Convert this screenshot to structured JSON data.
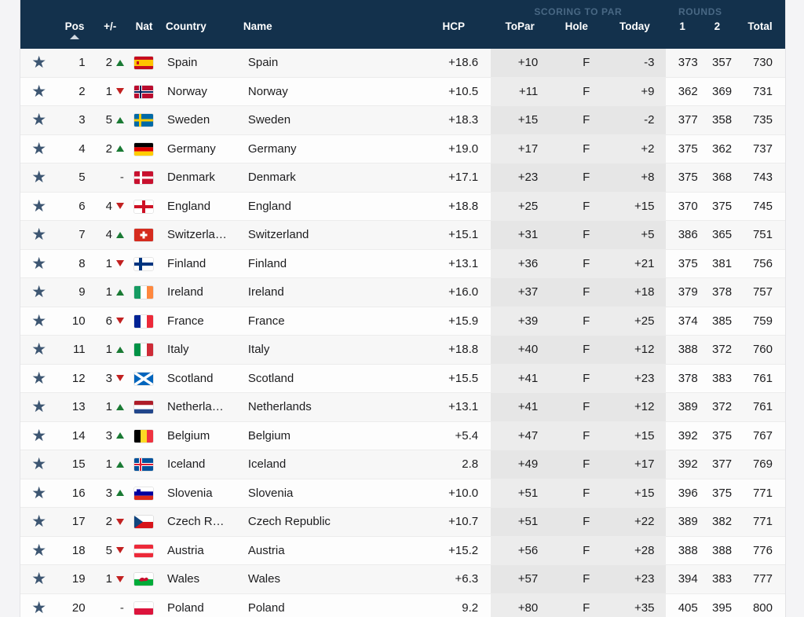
{
  "table": {
    "group_headers": [
      {
        "label": "SCORING TO PAR"
      },
      {
        "label": "ROUNDS"
      }
    ],
    "columns": {
      "star": "",
      "pos": "Pos",
      "change": "+/-",
      "nat": "Nat",
      "country": "Country",
      "name": "Name",
      "hcp": "HCP",
      "topar": "ToPar",
      "hole": "Hole",
      "today": "Today",
      "round1": "1",
      "round2": "2",
      "total": "Total"
    },
    "sort": {
      "column": "Pos",
      "direction": "ascending",
      "icon": "caret-up-icon"
    },
    "colors": {
      "header_bg": "#13314c",
      "group_label": "#496884",
      "star": "#3d5672",
      "arrow_up": "#1a7a34",
      "arrow_down": "#c22121",
      "row_odd": "#f7f7f7",
      "row_even": "#fdfdfd",
      "group_col_odd": "#e6e6e6",
      "group_col_even": "#ececec"
    },
    "rows": [
      {
        "star": "★",
        "pos": "1",
        "change": "2",
        "dir": "up",
        "flag": "es",
        "country": "Spain",
        "country_full": "Spain",
        "name": "Spain",
        "hcp": "+18.6",
        "topar": "+10",
        "hole": "F",
        "today": "-3",
        "r1": "373",
        "r2": "357",
        "total": "730"
      },
      {
        "star": "★",
        "pos": "2",
        "change": "1",
        "dir": "down",
        "flag": "no",
        "country": "Norway",
        "country_full": "Norway",
        "name": "Norway",
        "hcp": "+10.5",
        "topar": "+11",
        "hole": "F",
        "today": "+9",
        "r1": "362",
        "r2": "369",
        "total": "731"
      },
      {
        "star": "★",
        "pos": "3",
        "change": "5",
        "dir": "up",
        "flag": "se",
        "country": "Sweden",
        "country_full": "Sweden",
        "name": "Sweden",
        "hcp": "+18.3",
        "topar": "+15",
        "hole": "F",
        "today": "-2",
        "r1": "377",
        "r2": "358",
        "total": "735"
      },
      {
        "star": "★",
        "pos": "4",
        "change": "2",
        "dir": "up",
        "flag": "de",
        "country": "Germany",
        "country_full": "Germany",
        "name": "Germany",
        "hcp": "+19.0",
        "topar": "+17",
        "hole": "F",
        "today": "+2",
        "r1": "375",
        "r2": "362",
        "total": "737"
      },
      {
        "star": "★",
        "pos": "5",
        "change": "-",
        "dir": "none",
        "flag": "dk",
        "country": "Denmark",
        "country_full": "Denmark",
        "name": "Denmark",
        "hcp": "+17.1",
        "topar": "+23",
        "hole": "F",
        "today": "+8",
        "r1": "375",
        "r2": "368",
        "total": "743"
      },
      {
        "star": "★",
        "pos": "6",
        "change": "4",
        "dir": "down",
        "flag": "en",
        "country": "England",
        "country_full": "England",
        "name": "England",
        "hcp": "+18.8",
        "topar": "+25",
        "hole": "F",
        "today": "+15",
        "r1": "370",
        "r2": "375",
        "total": "745"
      },
      {
        "star": "★",
        "pos": "7",
        "change": "4",
        "dir": "up",
        "flag": "ch",
        "country": "Switzerla…",
        "country_full": "Switzerland",
        "name": "Switzerland",
        "hcp": "+15.1",
        "topar": "+31",
        "hole": "F",
        "today": "+5",
        "r1": "386",
        "r2": "365",
        "total": "751"
      },
      {
        "star": "★",
        "pos": "8",
        "change": "1",
        "dir": "down",
        "flag": "fi",
        "country": "Finland",
        "country_full": "Finland",
        "name": "Finland",
        "hcp": "+13.1",
        "topar": "+36",
        "hole": "F",
        "today": "+21",
        "r1": "375",
        "r2": "381",
        "total": "756"
      },
      {
        "star": "★",
        "pos": "9",
        "change": "1",
        "dir": "up",
        "flag": "ie",
        "country": "Ireland",
        "country_full": "Ireland",
        "name": "Ireland",
        "hcp": "+16.0",
        "topar": "+37",
        "hole": "F",
        "today": "+18",
        "r1": "379",
        "r2": "378",
        "total": "757"
      },
      {
        "star": "★",
        "pos": "10",
        "change": "6",
        "dir": "down",
        "flag": "fr",
        "country": "France",
        "country_full": "France",
        "name": "France",
        "hcp": "+15.9",
        "topar": "+39",
        "hole": "F",
        "today": "+25",
        "r1": "374",
        "r2": "385",
        "total": "759"
      },
      {
        "star": "★",
        "pos": "11",
        "change": "1",
        "dir": "up",
        "flag": "it",
        "country": "Italy",
        "country_full": "Italy",
        "name": "Italy",
        "hcp": "+18.8",
        "topar": "+40",
        "hole": "F",
        "today": "+12",
        "r1": "388",
        "r2": "372",
        "total": "760"
      },
      {
        "star": "★",
        "pos": "12",
        "change": "3",
        "dir": "down",
        "flag": "sc",
        "country": "Scotland",
        "country_full": "Scotland",
        "name": "Scotland",
        "hcp": "+15.5",
        "topar": "+41",
        "hole": "F",
        "today": "+23",
        "r1": "378",
        "r2": "383",
        "total": "761"
      },
      {
        "star": "★",
        "pos": "13",
        "change": "1",
        "dir": "up",
        "flag": "nl",
        "country": "Netherla…",
        "country_full": "Netherlands",
        "name": "Netherlands",
        "hcp": "+13.1",
        "topar": "+41",
        "hole": "F",
        "today": "+12",
        "r1": "389",
        "r2": "372",
        "total": "761"
      },
      {
        "star": "★",
        "pos": "14",
        "change": "3",
        "dir": "up",
        "flag": "be",
        "country": "Belgium",
        "country_full": "Belgium",
        "name": "Belgium",
        "hcp": "+5.4",
        "topar": "+47",
        "hole": "F",
        "today": "+15",
        "r1": "392",
        "r2": "375",
        "total": "767"
      },
      {
        "star": "★",
        "pos": "15",
        "change": "1",
        "dir": "up",
        "flag": "is",
        "country": "Iceland",
        "country_full": "Iceland",
        "name": "Iceland",
        "hcp": "2.8",
        "topar": "+49",
        "hole": "F",
        "today": "+17",
        "r1": "392",
        "r2": "377",
        "total": "769"
      },
      {
        "star": "★",
        "pos": "16",
        "change": "3",
        "dir": "up",
        "flag": "si",
        "country": "Slovenia",
        "country_full": "Slovenia",
        "name": "Slovenia",
        "hcp": "+10.0",
        "topar": "+51",
        "hole": "F",
        "today": "+15",
        "r1": "396",
        "r2": "375",
        "total": "771"
      },
      {
        "star": "★",
        "pos": "17",
        "change": "2",
        "dir": "down",
        "flag": "cz",
        "country": "Czech R…",
        "country_full": "Czech Republic",
        "name": "Czech Republic",
        "hcp": "+10.7",
        "topar": "+51",
        "hole": "F",
        "today": "+22",
        "r1": "389",
        "r2": "382",
        "total": "771"
      },
      {
        "star": "★",
        "pos": "18",
        "change": "5",
        "dir": "down",
        "flag": "at",
        "country": "Austria",
        "country_full": "Austria",
        "name": "Austria",
        "hcp": "+15.2",
        "topar": "+56",
        "hole": "F",
        "today": "+28",
        "r1": "388",
        "r2": "388",
        "total": "776"
      },
      {
        "star": "★",
        "pos": "19",
        "change": "1",
        "dir": "down",
        "flag": "wa",
        "country": "Wales",
        "country_full": "Wales",
        "name": "Wales",
        "hcp": "+6.3",
        "topar": "+57",
        "hole": "F",
        "today": "+23",
        "r1": "394",
        "r2": "383",
        "total": "777"
      },
      {
        "star": "★",
        "pos": "20",
        "change": "-",
        "dir": "none",
        "flag": "pl",
        "country": "Poland",
        "country_full": "Poland",
        "name": "Poland",
        "hcp": "9.2",
        "topar": "+80",
        "hole": "F",
        "today": "+35",
        "r1": "405",
        "r2": "395",
        "total": "800"
      }
    ]
  }
}
